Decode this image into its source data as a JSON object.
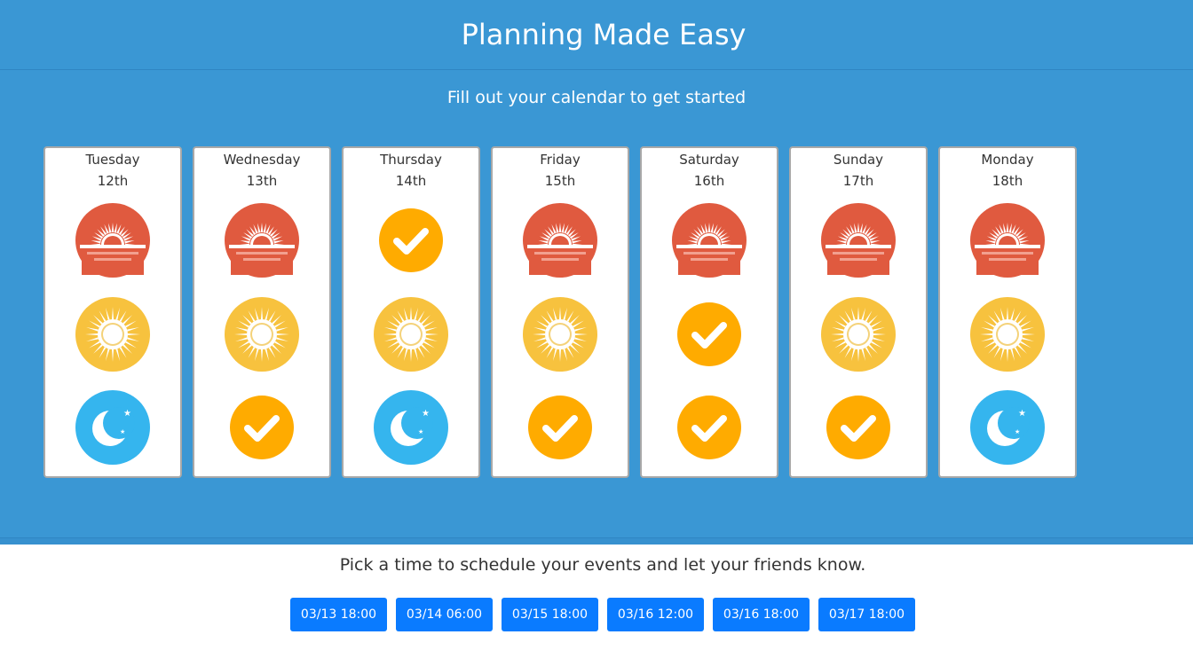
{
  "header": {
    "title": "Planning Made Easy"
  },
  "hero": {
    "subtitle": "Fill out your calendar to get started"
  },
  "days": [
    {
      "name": "Tuesday",
      "date": "12th",
      "slots": [
        "sunrise-icon",
        "sun-icon",
        "moon-icon"
      ]
    },
    {
      "name": "Wednesday",
      "date": "13th",
      "slots": [
        "sunrise-icon",
        "sun-icon",
        "check-icon"
      ]
    },
    {
      "name": "Thursday",
      "date": "14th",
      "slots": [
        "check-icon",
        "sun-icon",
        "moon-icon"
      ]
    },
    {
      "name": "Friday",
      "date": "15th",
      "slots": [
        "sunrise-icon",
        "sun-icon",
        "check-icon"
      ]
    },
    {
      "name": "Saturday",
      "date": "16th",
      "slots": [
        "sunrise-icon",
        "check-icon",
        "check-icon"
      ]
    },
    {
      "name": "Sunday",
      "date": "17th",
      "slots": [
        "sunrise-icon",
        "sun-icon",
        "check-icon"
      ]
    },
    {
      "name": "Monday",
      "date": "18th",
      "slots": [
        "sunrise-icon",
        "sun-icon",
        "moon-icon"
      ]
    }
  ],
  "footer": {
    "text": "Pick a time to schedule your events and let your friends know.",
    "times": [
      "03/13 18:00",
      "03/14 06:00",
      "03/15 18:00",
      "03/16 12:00",
      "03/16 18:00",
      "03/17 18:00"
    ]
  },
  "colors": {
    "hero_bg": "#3a97d4",
    "sunrise": "#e05a3f",
    "sun": "#f7c23e",
    "moon": "#35b5ee",
    "check": "#ffab00",
    "button": "#0a7bff"
  }
}
